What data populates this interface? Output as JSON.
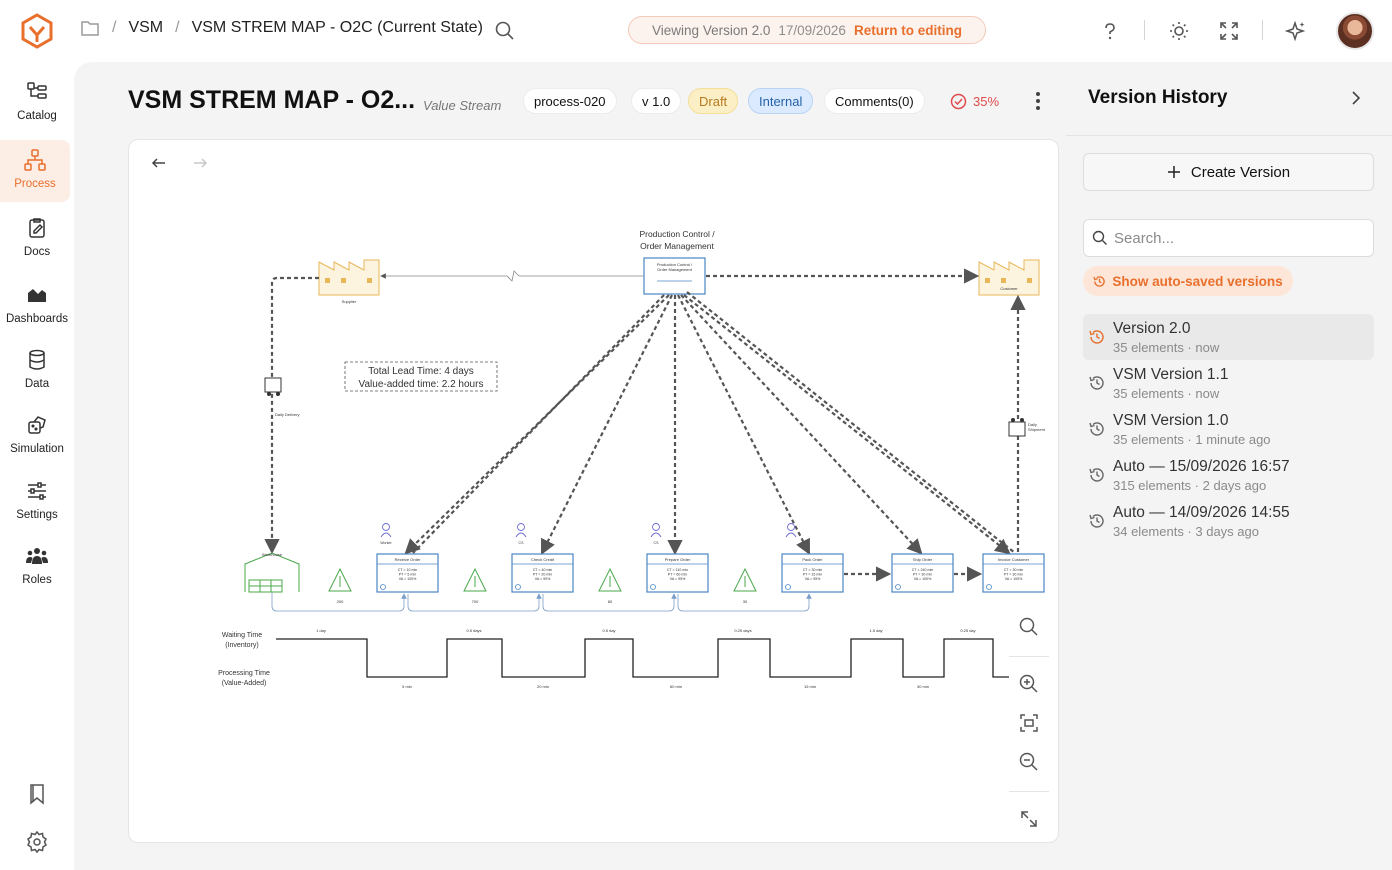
{
  "breadcrumb": {
    "items": [
      "VSM",
      "VSM STREM MAP - O2C (Current State)"
    ]
  },
  "version_banner": {
    "viewing": "Viewing Version 2.0",
    "date": "17/09/2026",
    "return_label": "Return to editing"
  },
  "sidebar": {
    "items": [
      {
        "label": "Catalog",
        "icon": "catalog-icon"
      },
      {
        "label": "Process",
        "icon": "process-icon",
        "active": true
      },
      {
        "label": "Docs",
        "icon": "docs-icon"
      },
      {
        "label": "Dashboards",
        "icon": "dashboards-icon"
      },
      {
        "label": "Data",
        "icon": "database-icon"
      },
      {
        "label": "Simulation",
        "icon": "simulation-icon"
      },
      {
        "label": "Settings",
        "icon": "settings-sliders-icon"
      },
      {
        "label": "Roles",
        "icon": "users-icon"
      }
    ]
  },
  "header": {
    "title": "VSM STREM MAP - O2...",
    "subtitle": "Value Stream",
    "process_id": "process-020",
    "version": "v 1.0",
    "status": "Draft",
    "visibility": "Internal",
    "comments": "Comments(0)",
    "score": "35%"
  },
  "diagram": {
    "control": {
      "title": "Production Control /\nOrder Management",
      "box_text": "Production Control /\nOrder Management"
    },
    "supplier": "Supplier",
    "customer": "Customer",
    "warehouse": "Warehouse",
    "daily_delivery": "Daily Delivery",
    "daily_shipment": "Daily\nShipment",
    "summary": {
      "lead": "Total Lead Time: 4 days",
      "value_added": "Value-added time: 2.2 hours"
    },
    "processes": [
      {
        "name": "Receive Order",
        "ct": "CT = 10 min",
        "pt": "PT = 5 min",
        "va": "VA = 100%",
        "operator": "Worker"
      },
      {
        "name": "Check Credit",
        "ct": "CT = 40 min",
        "pt": "PT = 20 min",
        "va": "VA = 90%",
        "operator": "CS"
      },
      {
        "name": "Prepare Order",
        "ct": "CT = 110 min",
        "pt": "PT = 60 min",
        "va": "VA = 95%",
        "operator": "CS"
      },
      {
        "name": "Pack Order",
        "ct": "CT = 30 min",
        "pt": "PT = 15 min",
        "va": "VA = 95%",
        "operator": ""
      },
      {
        "name": "Ship Order",
        "ct": "CT = 240 min",
        "pt": "PT = 30 min",
        "va": "VA = 100%",
        "operator": ""
      },
      {
        "name": "Invoice Customer",
        "ct": "CT = 30 min",
        "pt": "PT = 30 min",
        "va": "VA = 100%",
        "operator": ""
      }
    ],
    "inventory": [
      "200",
      "700",
      "80",
      "30"
    ],
    "timeline": {
      "wait_label": "Waiting Time\n(Inventory)",
      "proc_label": "Processing Time\n(Value-Added)",
      "waits": [
        "1 day",
        "0.5 days",
        "0.5 day",
        "0.25 days",
        "1.5 day",
        "0.25 day"
      ],
      "procs": [
        "5 min",
        "20 min",
        "60 min",
        "15 min",
        "30 min"
      ]
    }
  },
  "version_history": {
    "title": "Version History",
    "create_label": "Create Version",
    "search_placeholder": "Search...",
    "autosave_label": "Show auto-saved versions",
    "items": [
      {
        "name": "Version 2.0",
        "meta": "35 elements · now",
        "active": true
      },
      {
        "name": "VSM Version 1.1",
        "meta": "35 elements · now"
      },
      {
        "name": "VSM Version 1.0",
        "meta": "35 elements · 1 minute ago"
      },
      {
        "name": "Auto — 15/09/2026 16:57",
        "meta": "315 elements · 2 days ago"
      },
      {
        "name": "Auto — 14/09/2026 14:55",
        "meta": "34 elements · 3 days ago"
      }
    ]
  }
}
